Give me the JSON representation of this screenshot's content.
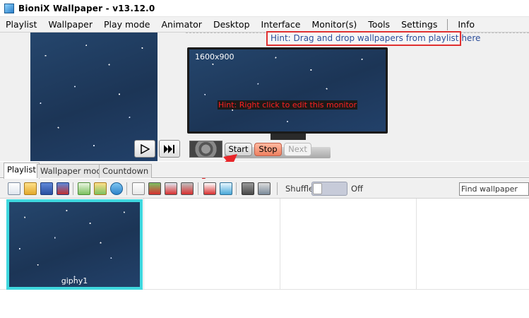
{
  "window": {
    "title": "BioniX Wallpaper -  v13.12.0"
  },
  "menu": {
    "items": [
      "Playlist",
      "Wallpaper",
      "Play mode",
      "Animator",
      "Desktop",
      "Interface",
      "Monitor(s)",
      "Tools",
      "Settings",
      "Info"
    ]
  },
  "preview": {
    "drop_hint": "Hint: Drag and drop wallpapers from playlist here",
    "monitor_resolution": "1600x900",
    "monitor_hint": "Hint: Right click to edit this monitor"
  },
  "controls": {
    "play_icon": "play-icon",
    "skip_icon": "skip-next-icon",
    "start_label": "Start",
    "stop_label": "Stop",
    "next_label": "Next"
  },
  "tabs": [
    "Playlist",
    "Wallpaper mode",
    "Countdown"
  ],
  "toolbar": {
    "shuffle_label": "Shuffle",
    "shuffle_state": "Off",
    "search_placeholder": "Find wallpaper"
  },
  "playlist": {
    "items": [
      {
        "name": "giphy1"
      }
    ]
  },
  "colors": {
    "hint_border": "#e03030",
    "selection_border": "#3fd8df",
    "stop_button": "#ef8060"
  }
}
